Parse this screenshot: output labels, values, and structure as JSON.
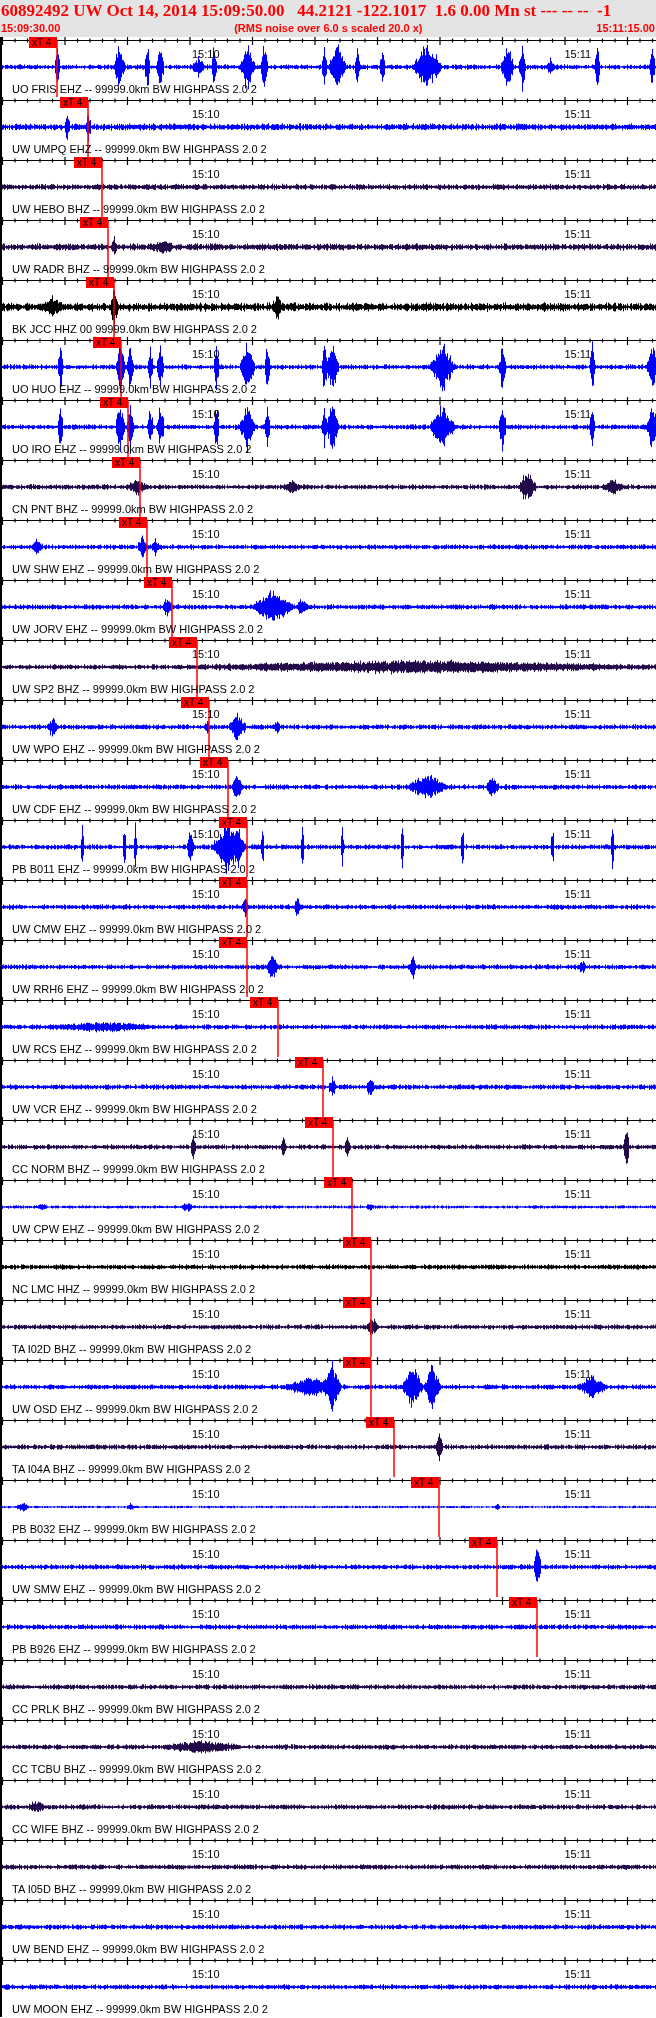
{
  "header": {
    "title": "60892492 UW Oct 14, 2014 15:09:50.00   44.2121 -122.1017  1.6 0.00 Mn st --- -- --  -1",
    "start_time": "15:09:30.00",
    "note": "(RMS noise over 6.0 s scaled 20.0 x)",
    "end_time": "15:11:15.00"
  },
  "traces": [
    {
      "label": "UO FRIS EHZ -- 99999.0km BW HIGHPASS 2.0 2",
      "color": "#0000ff",
      "tick_labels": [
        "15:10",
        "15:11"
      ],
      "pick": "xT 4"
    },
    {
      "label": "UW UMPQ EHZ -- 99999.0km BW HIGHPASS 2.0 2",
      "color": "#0000ff",
      "tick_labels": [
        "15:10",
        "15:11"
      ],
      "pick": "xT 4"
    },
    {
      "label": "UW HEBO BHZ -- 99999.0km BW HIGHPASS 2.0 2",
      "color": "#220a4a",
      "tick_labels": [
        "15:10",
        "15:11"
      ],
      "pick": "xT 4"
    },
    {
      "label": "UW RADR BHZ -- 99999.0km BW HIGHPASS 2.0 2",
      "color": "#220a4a",
      "tick_labels": [
        "15:10",
        "15:11"
      ],
      "pick": "xT 4"
    },
    {
      "label": "BK JCC HHZ 00 99999.0km BW HIGHPASS 2.0 2",
      "color": "#000000",
      "tick_labels": [
        "15:10",
        "15:11"
      ],
      "pick": "xT 4"
    },
    {
      "label": "UO HUO EHZ -- 99999.0km BW HIGHPASS 2.0 2",
      "color": "#0000ff",
      "tick_labels": [
        "15:10",
        "15:11"
      ],
      "pick": "xT 4"
    },
    {
      "label": "UO IRO EHZ -- 99999.0km BW HIGHPASS 2.0 2",
      "color": "#0000ff",
      "tick_labels": [
        "15:10",
        "15:11"
      ],
      "pick": "xT 4"
    },
    {
      "label": "CN PNT BHZ -- 99999.0km BW HIGHPASS 2.0 2",
      "color": "#220a4a",
      "tick_labels": [
        "15:10",
        "15:11"
      ],
      "pick": "xT 4"
    },
    {
      "label": "UW SHW EHZ -- 99999.0km BW HIGHPASS 2.0 2",
      "color": "#0000ff",
      "tick_labels": [
        "15:10",
        "15:11"
      ],
      "pick": "xT 4"
    },
    {
      "label": "UW JORV EHZ -- 99999.0km BW HIGHPASS 2.0 2",
      "color": "#0000ff",
      "tick_labels": [
        "15:10",
        "15:11"
      ],
      "pick": "xT 4"
    },
    {
      "label": "UW SP2 BHZ -- 99999.0km BW HIGHPASS 2.0 2",
      "color": "#220a4a",
      "tick_labels": [
        "15:10",
        "15:11"
      ],
      "pick": "xT 4"
    },
    {
      "label": "UW WPO EHZ -- 99999.0km BW HIGHPASS 2.0 2",
      "color": "#0000ff",
      "tick_labels": [
        "15:10",
        "15:11"
      ],
      "pick": "xT 4"
    },
    {
      "label": "UW CDF EHZ -- 99999.0km BW HIGHPASS 2.0 2",
      "color": "#0000ff",
      "tick_labels": [
        "15:10",
        "15:11"
      ],
      "pick": "xT 4"
    },
    {
      "label": "PB B011 EHZ -- 99999.0km BW HIGHPASS 2.0 2",
      "color": "#0000ff",
      "tick_labels": [
        "15:10",
        "15:11"
      ],
      "pick": "xT 4"
    },
    {
      "label": "UW CMW EHZ -- 99999.0km BW HIGHPASS 2.0 2",
      "color": "#0000ff",
      "tick_labels": [
        "15:10",
        "15:11"
      ],
      "pick": "xT 4"
    },
    {
      "label": "UW RRH6 EHZ -- 99999.0km BW HIGHPASS 2.0 2",
      "color": "#0000ff",
      "tick_labels": [
        "15:10",
        "15:11"
      ],
      "pick": "xT 4"
    },
    {
      "label": "UW RCS EHZ -- 99999.0km BW HIGHPASS 2.0 2",
      "color": "#0000ff",
      "tick_labels": [
        "15:10",
        "15:11"
      ],
      "pick": "xT 4"
    },
    {
      "label": "UW VCR EHZ -- 99999.0km BW HIGHPASS 2.0 2",
      "color": "#0000ff",
      "tick_labels": [
        "15:10",
        "15:11"
      ],
      "pick": "xT 4"
    },
    {
      "label": "CC NORM BHZ -- 99999.0km BW HIGHPASS 2.0 2",
      "color": "#220a4a",
      "tick_labels": [
        "15:10",
        "15:11"
      ],
      "pick": "xT 4"
    },
    {
      "label": "UW CPW EHZ -- 99999.0km BW HIGHPASS 2.0 2",
      "color": "#0000ff",
      "tick_labels": [
        "15:10",
        "15:11"
      ],
      "pick": "xT 4"
    },
    {
      "label": "NC LMC HHZ -- 99999.0km BW HIGHPASS 2.0 2",
      "color": "#000000",
      "tick_labels": [
        "15:10",
        "15:11"
      ],
      "pick": "xT 4"
    },
    {
      "label": "TA I02D BHZ -- 99999.0km BW HIGHPASS 2.0 2",
      "color": "#220a4a",
      "tick_labels": [
        "15:10",
        "15:11"
      ],
      "pick": "xT 4"
    },
    {
      "label": "UW OSD EHZ -- 99999.0km BW HIGHPASS 2.0 2",
      "color": "#0000ff",
      "tick_labels": [
        "15:10",
        "15:11"
      ],
      "pick": "xT 4"
    },
    {
      "label": "TA I04A BHZ -- 99999.0km BW HIGHPASS 2.0 2",
      "color": "#220a4a",
      "tick_labels": [
        "15:10",
        "15:11"
      ],
      "pick": "xT 4"
    },
    {
      "label": "PB B032 EHZ -- 99999.0km BW HIGHPASS 2.0 2",
      "color": "#0000ff",
      "tick_labels": [
        "15:10",
        "15:11"
      ],
      "pick": "xT 4"
    },
    {
      "label": "UW SMW EHZ -- 99999.0km BW HIGHPASS 2.0 2",
      "color": "#0000ff",
      "tick_labels": [
        "15:10",
        "15:11"
      ],
      "pick": "xT 4"
    },
    {
      "label": "PB B926 EHZ -- 99999.0km BW HIGHPASS 2.0 2",
      "color": "#0000ff",
      "tick_labels": [
        "15:10",
        "15:11"
      ],
      "pick": "xT 4"
    },
    {
      "label": "CC PRLK BHZ -- 99999.0km BW HIGHPASS 2.0 2",
      "color": "#220a4a",
      "tick_labels": [
        "15:10",
        "15:11"
      ]
    },
    {
      "label": "CC TCBU BHZ -- 99999.0km BW HIGHPASS 2.0 2",
      "color": "#220a4a",
      "tick_labels": [
        "15:10",
        "15:11"
      ]
    },
    {
      "label": "CC WIFE BHZ -- 99999.0km BW HIGHPASS 2.0 2",
      "color": "#220a4a",
      "tick_labels": [
        "15:10",
        "15:11"
      ]
    },
    {
      "label": "TA I05D BHZ -- 99999.0km BW HIGHPASS 2.0 2",
      "color": "#220a4a",
      "tick_labels": [
        "15:10",
        "15:11"
      ]
    },
    {
      "label": "UW BEND EHZ -- 99999.0km BW HIGHPASS 2.0 2",
      "color": "#0000ff",
      "tick_labels": [
        "15:10",
        "15:11"
      ]
    },
    {
      "label": "UW MOON EHZ -- 99999.0km BW HIGHPASS 2.0 2",
      "color": "#0000ff",
      "tick_labels": [
        "15:10",
        "15:11"
      ]
    }
  ]
}
